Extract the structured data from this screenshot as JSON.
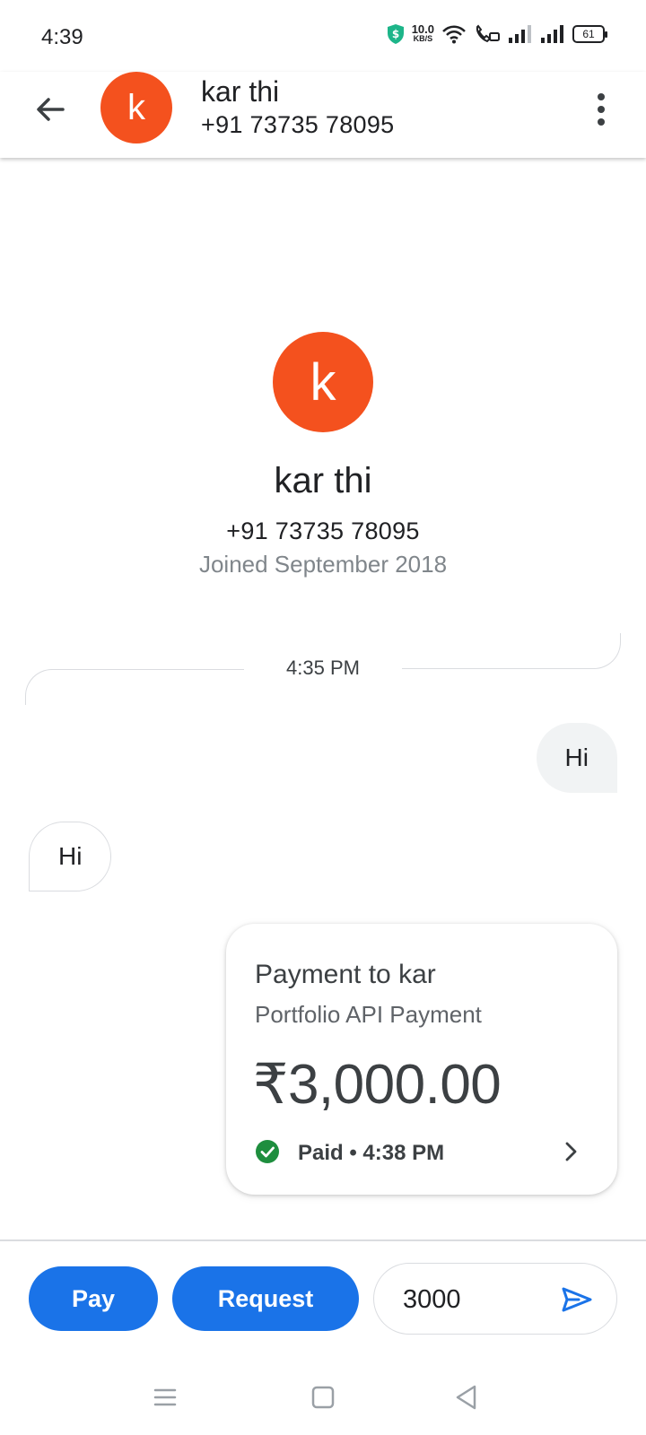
{
  "status_bar": {
    "time": "4:39",
    "speed_value": "10.0",
    "speed_unit": "KB/S",
    "battery": "61"
  },
  "header": {
    "contact_initial": "k",
    "contact_name": "kar thi",
    "contact_phone": "+91 73735 78095"
  },
  "profile": {
    "initial": "k",
    "name": "kar thi",
    "phone": "+91 73735 78095",
    "joined": "Joined September 2018"
  },
  "conversation": {
    "timestamp": "4:35 PM",
    "messages": [
      {
        "direction": "outgoing",
        "text": "Hi"
      },
      {
        "direction": "incoming",
        "text": "Hi"
      }
    ],
    "payment_card": {
      "title": "Payment to kar",
      "note": "Portfolio API Payment",
      "amount": "₹3,000.00",
      "status": "Paid • 4:38 PM"
    }
  },
  "compose": {
    "pay_label": "Pay",
    "request_label": "Request",
    "input_value": "3000"
  },
  "colors": {
    "avatar": "#f4511e",
    "primary": "#1a73e8",
    "success": "#1e8e3e"
  },
  "icons": [
    "back-arrow-icon",
    "more-vert-icon",
    "check-circle-icon",
    "chevron-right-icon",
    "send-icon",
    "menu-icon",
    "home-square-icon",
    "back-triangle-icon"
  ]
}
